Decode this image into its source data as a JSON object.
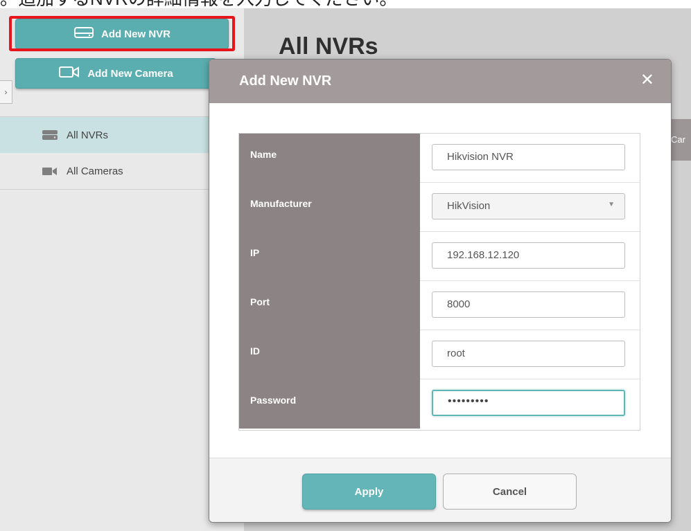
{
  "caption": "。追加するNVRの詳細情報を入力してください。",
  "sidebar": {
    "add_nvr_label": "Add New NVR",
    "add_camera_label": "Add New Camera",
    "collapse_glyph": "›",
    "items": [
      {
        "label": "All NVRs",
        "icon": "nvr-icon"
      },
      {
        "label": "All Cameras",
        "icon": "camera-icon"
      }
    ]
  },
  "main": {
    "title": "All NVRs",
    "column_header_partial": "Car"
  },
  "dialog": {
    "title": "Add New NVR",
    "close_glyph": "✕",
    "fields": [
      {
        "label": "Name",
        "value": "Hikvision NVR"
      },
      {
        "label": "Manufacturer",
        "value": "HikVision"
      },
      {
        "label": "IP",
        "value": "192.168.12.120"
      },
      {
        "label": "Port",
        "value": "8000"
      },
      {
        "label": "ID",
        "value": "root"
      },
      {
        "label": "Password",
        "value": "•••••••••"
      }
    ],
    "apply_label": "Apply",
    "cancel_label": "Cancel"
  },
  "colors": {
    "accent_teal": "#5aaeb0",
    "dialog_header": "#a39a9b",
    "label_column": "#8c8384",
    "highlight_red": "#e8141b"
  }
}
